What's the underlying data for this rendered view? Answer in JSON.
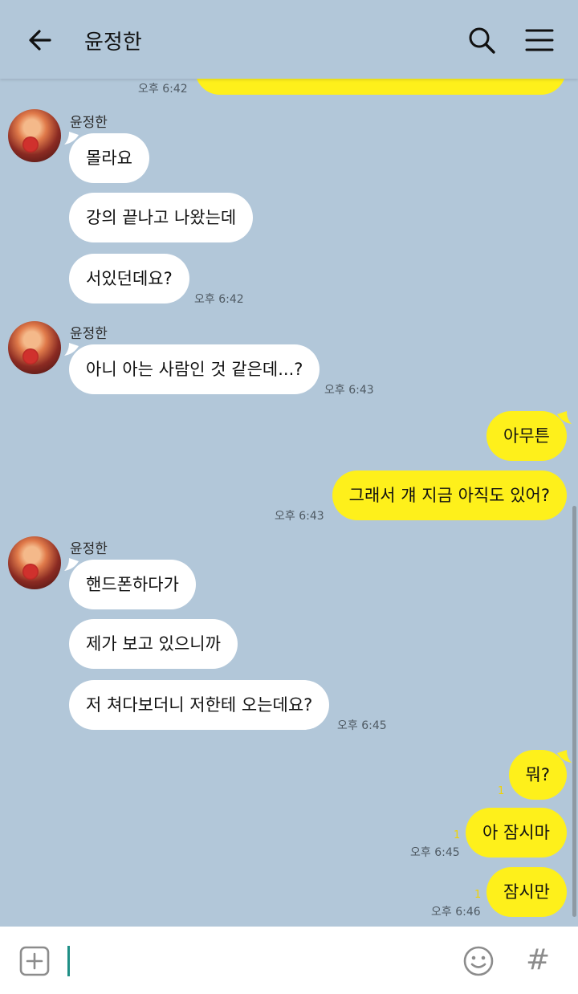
{
  "header": {
    "title": "윤정한",
    "icons": [
      "back-arrow-icon",
      "search-icon",
      "menu-icon"
    ]
  },
  "messages": {
    "top_time": "오후 6:42",
    "group1": {
      "sender": "윤정한",
      "lines": [
        "몰라요",
        "강의 끝나고 나왔는데",
        "서있던데요?"
      ],
      "time": "오후 6:42"
    },
    "group2": {
      "sender": "윤정한",
      "lines": [
        "아니 아는 사람인 것 같은데...?"
      ],
      "time": "오후 6:43"
    },
    "mine1": {
      "lines": [
        "아무튼",
        "그래서 걔 지금 아직도 있어?"
      ],
      "time": "오후 6:43"
    },
    "group3": {
      "sender": "윤정한",
      "lines": [
        "핸드폰하다가",
        "제가 보고 있으니까",
        "저 쳐다보더니 저한테 오는데요?"
      ],
      "time": "오후 6:45"
    },
    "mine2": {
      "m1": {
        "text": "뭐?",
        "unread": "1"
      },
      "m2": {
        "text": "아 잠시마",
        "unread": "1",
        "time": "오후 6:45"
      },
      "m3": {
        "text": "잠시만",
        "unread": "1",
        "time": "오후 6:46"
      }
    }
  },
  "colors": {
    "background": "#b2c7d9",
    "my_bubble": "#fef01b",
    "their_bubble": "#ffffff",
    "cursor": "#1f8f86"
  },
  "input": {
    "icons": [
      "plus-box-icon",
      "emoji-icon",
      "hashtag-icon"
    ],
    "hash_glyph": "#"
  }
}
